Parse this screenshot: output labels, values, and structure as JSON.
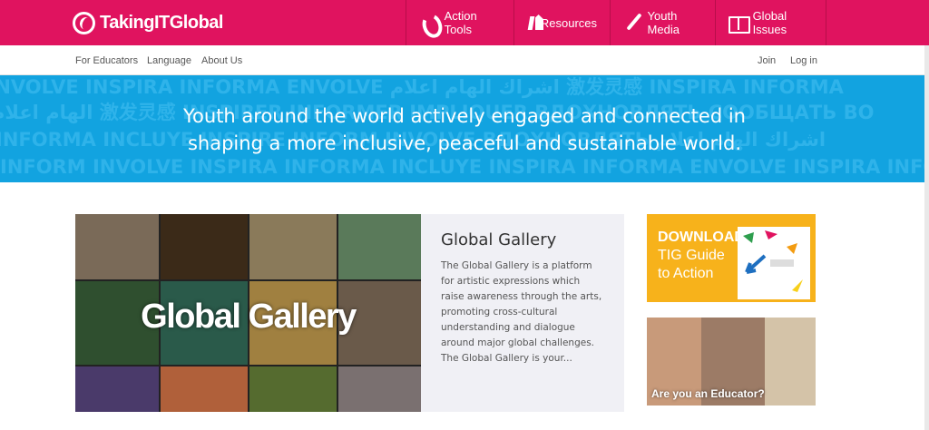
{
  "header": {
    "logo_text": "TakingITGlobal",
    "nav": [
      {
        "label": "Action Tools",
        "icon": "action-tools-icon"
      },
      {
        "label": "Resources",
        "icon": "resources-icon"
      },
      {
        "label": "Youth Media",
        "icon": "youth-media-icon"
      },
      {
        "label": "Global Issues",
        "icon": "global-issues-icon"
      }
    ]
  },
  "subnav": {
    "left": [
      "For Educators",
      "Language",
      "About Us"
    ],
    "right": [
      "Join",
      "Log in"
    ]
  },
  "hero": {
    "line1": "Youth around the world actively engaged and connected in",
    "line2": "shaping a more inclusive, peaceful and sustainable world.",
    "background_words": [
      "ENVOLVE  INSPIRA INFORMA ENVOLVE  اشراك  الهام اعلام  激发灵感  INSPIRA INFORMA",
      "الهام اعلام  激发灵感  INSPIRER INFORMER IMPLIQUER  ВДОХНОВЛЯТЬ СООБЩАТЬ ВО",
      "INFORMA INCLUYE  INSPIRE INFORM INVOLVE  ВДОХНОВЛЯТЬ  اشراك  الهام اعلام",
      "INFORM INVOLVE  INSPIRA INFORMA INCLUYE  INSPIRA INFORMA ENVOLVE  INSPIRA INFO"
    ]
  },
  "gallery": {
    "image_text": "Global Gallery",
    "title": "Global Gallery",
    "description": "The Global Gallery is a platform for artistic expressions which raise awareness through the arts, promoting cross-cultural understanding and dialogue around major global challenges. The Global Gallery is your..."
  },
  "promo": {
    "line1": "DOWNLOAD",
    "line2": "TIG Guide",
    "line3": "to Action"
  },
  "educator": {
    "label": "Are you an Educator?"
  },
  "colors": {
    "brand_pink": "#e0135f",
    "hero_blue": "#12a3e0",
    "promo_yellow": "#f7b21b"
  }
}
